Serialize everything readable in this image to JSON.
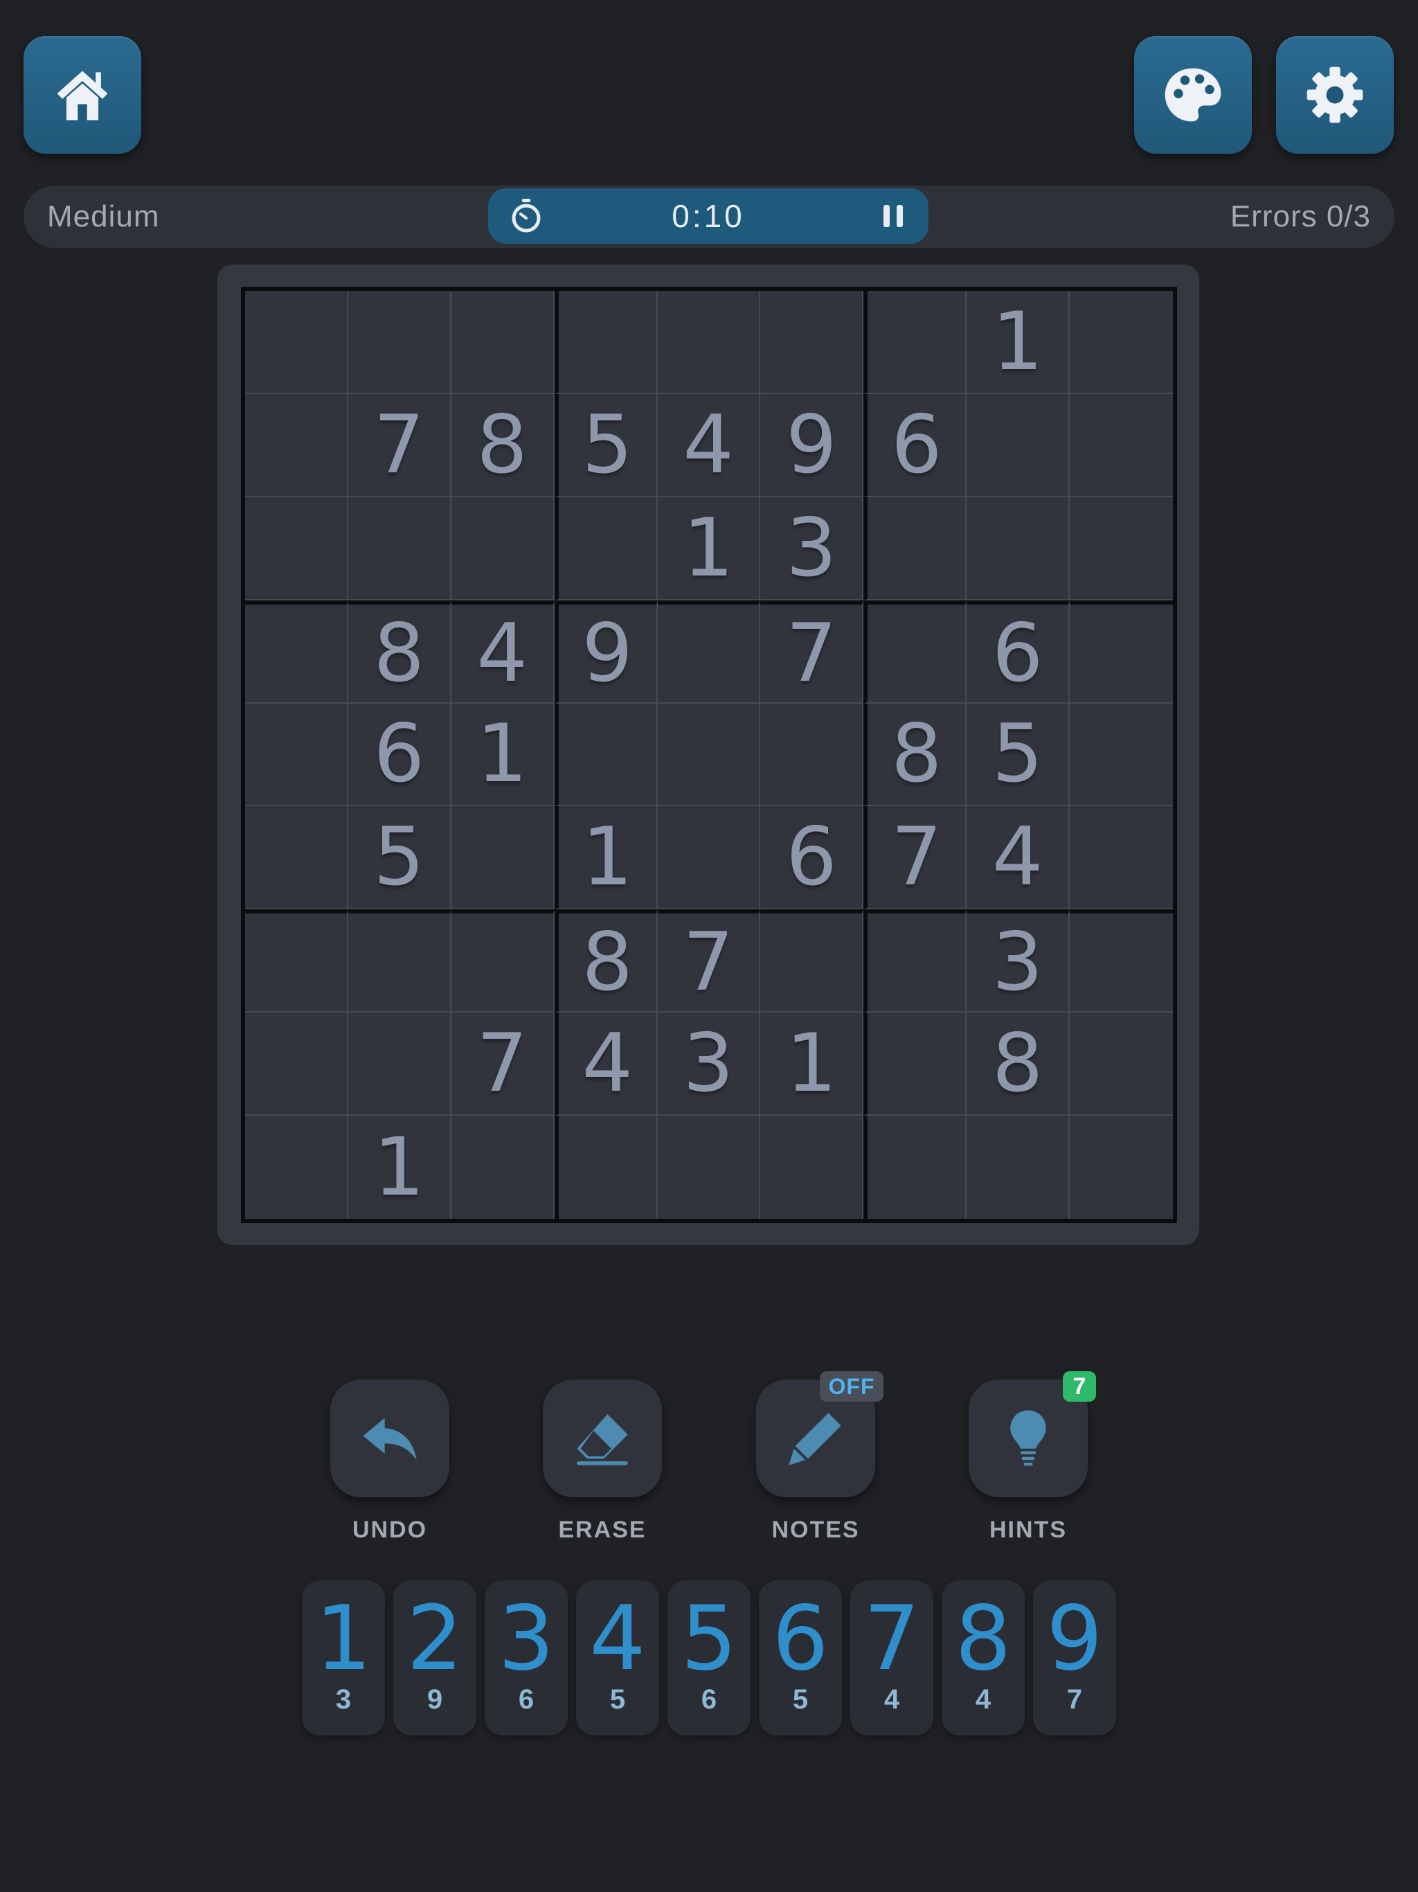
{
  "header": {
    "home_icon": "home-icon",
    "palette_icon": "palette-icon",
    "settings_icon": "gear-icon"
  },
  "status": {
    "difficulty": "Medium",
    "time": "0:10",
    "errors": "Errors 0/3",
    "timer_icon": "stopwatch-icon",
    "pause_icon": "pause-icon"
  },
  "board": [
    [
      "",
      "",
      "",
      "",
      "",
      "",
      "",
      "1",
      ""
    ],
    [
      "",
      "7",
      "8",
      "5",
      "4",
      "9",
      "6",
      "",
      ""
    ],
    [
      "",
      "",
      "",
      "",
      "1",
      "3",
      "",
      "",
      ""
    ],
    [
      "",
      "8",
      "4",
      "9",
      "",
      "7",
      "",
      "6",
      ""
    ],
    [
      "",
      "6",
      "1",
      "",
      "",
      "",
      "8",
      "5",
      ""
    ],
    [
      "",
      "5",
      "",
      "1",
      "",
      "6",
      "7",
      "4",
      ""
    ],
    [
      "",
      "",
      "",
      "8",
      "7",
      "",
      "",
      "3",
      ""
    ],
    [
      "",
      "",
      "7",
      "4",
      "3",
      "1",
      "",
      "8",
      ""
    ],
    [
      "",
      "1",
      "",
      "",
      "",
      "",
      "",
      "",
      ""
    ]
  ],
  "tools": {
    "undo": {
      "label": "UNDO",
      "icon": "undo-arrow-icon"
    },
    "erase": {
      "label": "ERASE",
      "icon": "eraser-icon"
    },
    "notes": {
      "label": "NOTES",
      "icon": "pencil-icon",
      "badge": "OFF"
    },
    "hints": {
      "label": "HINTS",
      "icon": "lightbulb-icon",
      "badge": "7"
    }
  },
  "numpad": [
    {
      "digit": "1",
      "remaining": "3"
    },
    {
      "digit": "2",
      "remaining": "9"
    },
    {
      "digit": "3",
      "remaining": "6"
    },
    {
      "digit": "4",
      "remaining": "5"
    },
    {
      "digit": "5",
      "remaining": "6"
    },
    {
      "digit": "6",
      "remaining": "5"
    },
    {
      "digit": "7",
      "remaining": "4"
    },
    {
      "digit": "8",
      "remaining": "4"
    },
    {
      "digit": "9",
      "remaining": "7"
    }
  ],
  "colors": {
    "background": "#202125",
    "accent": "#2f8fcc",
    "button_blue": "#1f5878",
    "hint_badge": "#2fb96a"
  }
}
